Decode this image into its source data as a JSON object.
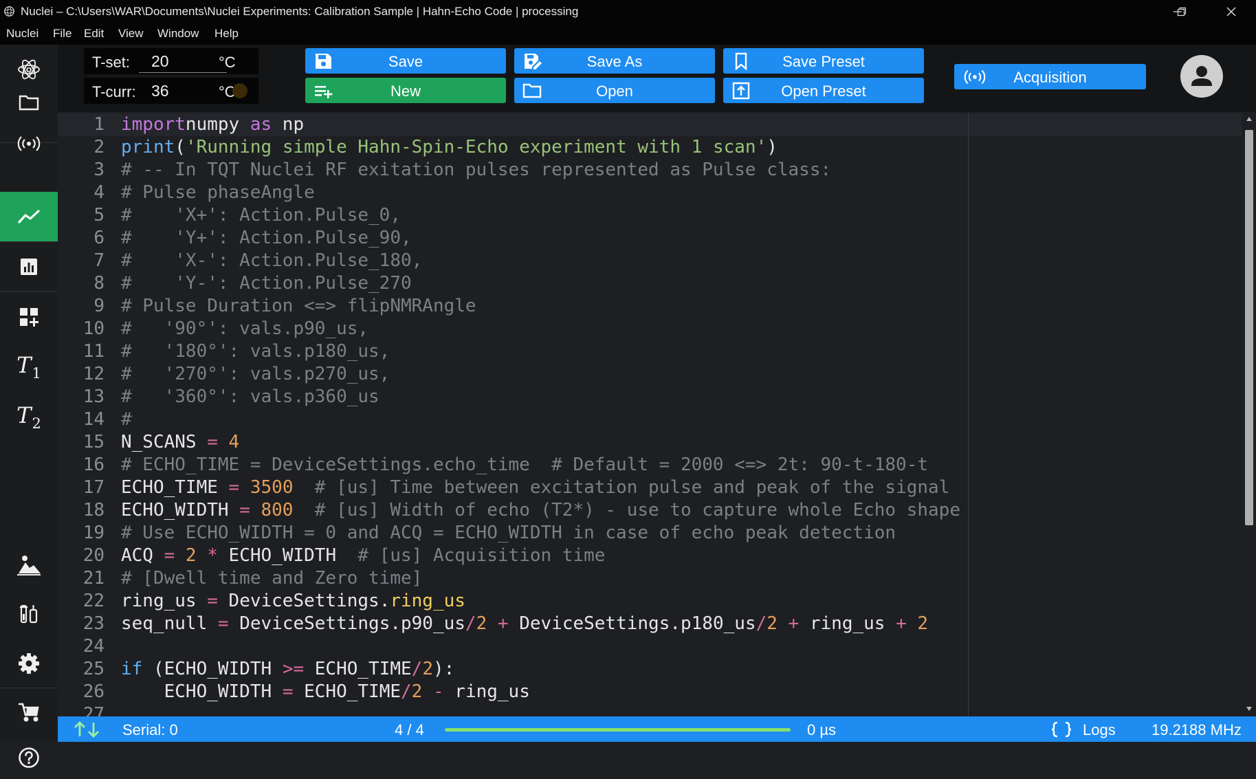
{
  "window": {
    "title": "Nuclei – C:\\Users\\WAR\\Documents\\Nuclei Experiments: Calibration Sample | Hahn-Echo Code | processing",
    "controls": [
      "minimize-icon",
      "restore-icon",
      "close-icon"
    ]
  },
  "menu": [
    "Nuclei",
    "File",
    "Edit",
    "View",
    "Window",
    "Help"
  ],
  "sidebar": {
    "items": [
      {
        "icon": "atom-logo-icon"
      },
      {
        "icon": "folder-icon"
      },
      {
        "icon": "broadcast-icon"
      },
      {
        "icon": "line-chart-icon",
        "active": true
      },
      {
        "icon": "bar-chart-icon"
      },
      {
        "icon": "dashboard-add-icon"
      },
      {
        "label": "T",
        "sub": "1"
      },
      {
        "label": "T",
        "sub": "2"
      },
      {
        "icon": "sample-icon"
      },
      {
        "icon": "tubes-icon"
      },
      {
        "icon": "gear-icon"
      },
      {
        "icon": "stroller-icon"
      },
      {
        "icon": "help-icon"
      }
    ]
  },
  "temperature": {
    "set_label": "T-set:",
    "set_value": "20",
    "curr_label": "T-curr:",
    "curr_value": "36",
    "unit": "°C"
  },
  "toolbar": {
    "save": "Save",
    "new": "New",
    "save_as": "Save As",
    "open": "Open",
    "save_preset": "Save Preset",
    "open_preset": "Open Preset",
    "acquisition": "Acquisition"
  },
  "editor": {
    "current_line": 1,
    "lines": [
      [
        [
          "kw",
          "import"
        ],
        [
          "",
          "numpy "
        ],
        [
          "kw",
          "as"
        ],
        [
          "",
          " np"
        ]
      ],
      [
        [
          "fn",
          "print"
        ],
        [
          "",
          "("
        ],
        [
          "str",
          "'Running simple Hahn-Spin-Echo experiment with 1 scan'"
        ],
        [
          "",
          ")"
        ]
      ],
      [
        [
          "cm",
          "# -- In TQT Nuclei RF exitation pulses represented as Pulse class:"
        ]
      ],
      [
        [
          "cm",
          "# Pulse phaseAngle"
        ]
      ],
      [
        [
          "cm",
          "#    'X+': Action.Pulse_0,"
        ]
      ],
      [
        [
          "cm",
          "#    'Y+': Action.Pulse_90,"
        ]
      ],
      [
        [
          "cm",
          "#    'X-': Action.Pulse_180,"
        ]
      ],
      [
        [
          "cm",
          "#    'Y-': Action.Pulse_270"
        ]
      ],
      [
        [
          "cm",
          "# Pulse Duration <=> flipNMRAngle"
        ]
      ],
      [
        [
          "cm",
          "#   '90°': vals.p90_us,"
        ]
      ],
      [
        [
          "cm",
          "#   '180°': vals.p180_us,"
        ]
      ],
      [
        [
          "cm",
          "#   '270°': vals.p270_us,"
        ]
      ],
      [
        [
          "cm",
          "#   '360°': vals.p360_us"
        ]
      ],
      [
        [
          "cm",
          "#"
        ]
      ],
      [
        [
          "",
          "N_SCANS "
        ],
        [
          "op",
          "="
        ],
        [
          "num",
          " 4"
        ]
      ],
      [
        [
          "cm",
          "# ECHO_TIME = DeviceSettings.echo_time  # Default = 2000 <=> 2t: 90-t-180-t"
        ]
      ],
      [
        [
          "",
          "ECHO_TIME "
        ],
        [
          "op",
          "="
        ],
        [
          "num",
          " 3500"
        ],
        [
          "cm",
          "  # [us] Time between excitation pulse and peak of the signal"
        ]
      ],
      [
        [
          "",
          "ECHO_WIDTH "
        ],
        [
          "op",
          "="
        ],
        [
          "num",
          " 800"
        ],
        [
          "cm",
          "  # [us] Width of echo (T2*) - use to capture whole Echo shape"
        ]
      ],
      [
        [
          "cm",
          "# Use ECHO_WIDTH = 0 and ACQ = ECHO_WIDTH in case of echo peak detection"
        ]
      ],
      [
        [
          "",
          "ACQ "
        ],
        [
          "op",
          "="
        ],
        [
          "num",
          " 2"
        ],
        [
          "op",
          " *"
        ],
        [
          "",
          " ECHO_WIDTH"
        ],
        [
          "cm",
          "  # [us] Acquisition time"
        ]
      ],
      [
        [
          "cm",
          "# [Dwell time and Zero time]"
        ]
      ],
      [
        [
          "",
          "ring_us "
        ],
        [
          "op",
          "="
        ],
        [
          "",
          " DeviceSettings."
        ],
        [
          "prop",
          "ring_us"
        ]
      ],
      [
        [
          "",
          "seq_null "
        ],
        [
          "op",
          "="
        ],
        [
          "",
          " DeviceSettings.p90_us"
        ],
        [
          "op",
          "/"
        ],
        [
          "num",
          "2"
        ],
        [
          "op",
          " +"
        ],
        [
          "",
          " DeviceSettings.p180_us"
        ],
        [
          "op",
          "/"
        ],
        [
          "num",
          "2"
        ],
        [
          "op",
          " +"
        ],
        [
          "",
          " ring_us "
        ],
        [
          "op",
          "+"
        ],
        [
          "num",
          " 2"
        ]
      ],
      [],
      [
        [
          "fn",
          "if"
        ],
        [
          "",
          " (ECHO_WIDTH "
        ],
        [
          "op",
          ">="
        ],
        [
          "",
          " ECHO_TIME"
        ],
        [
          "op",
          "/"
        ],
        [
          "num",
          "2"
        ],
        [
          "",
          "):"
        ]
      ],
      [
        [
          "",
          "    ECHO_WIDTH "
        ],
        [
          "op",
          "="
        ],
        [
          "",
          " ECHO_TIME"
        ],
        [
          "op",
          "/"
        ],
        [
          "num",
          "2"
        ],
        [
          "op",
          " -"
        ],
        [
          "",
          " ring_us"
        ]
      ]
    ]
  },
  "status": {
    "serial": "Serial: 0",
    "progress_text": "4 / 4",
    "progress": 1.0,
    "time": "0 µs",
    "logs": "Logs",
    "frequency": "19.2188 MHz"
  },
  "colors": {
    "accent_blue": "#1e8cf0",
    "accent_green": "#1fa35a",
    "progress_green": "#86e06a",
    "editor_bg": "#1e1f23"
  }
}
